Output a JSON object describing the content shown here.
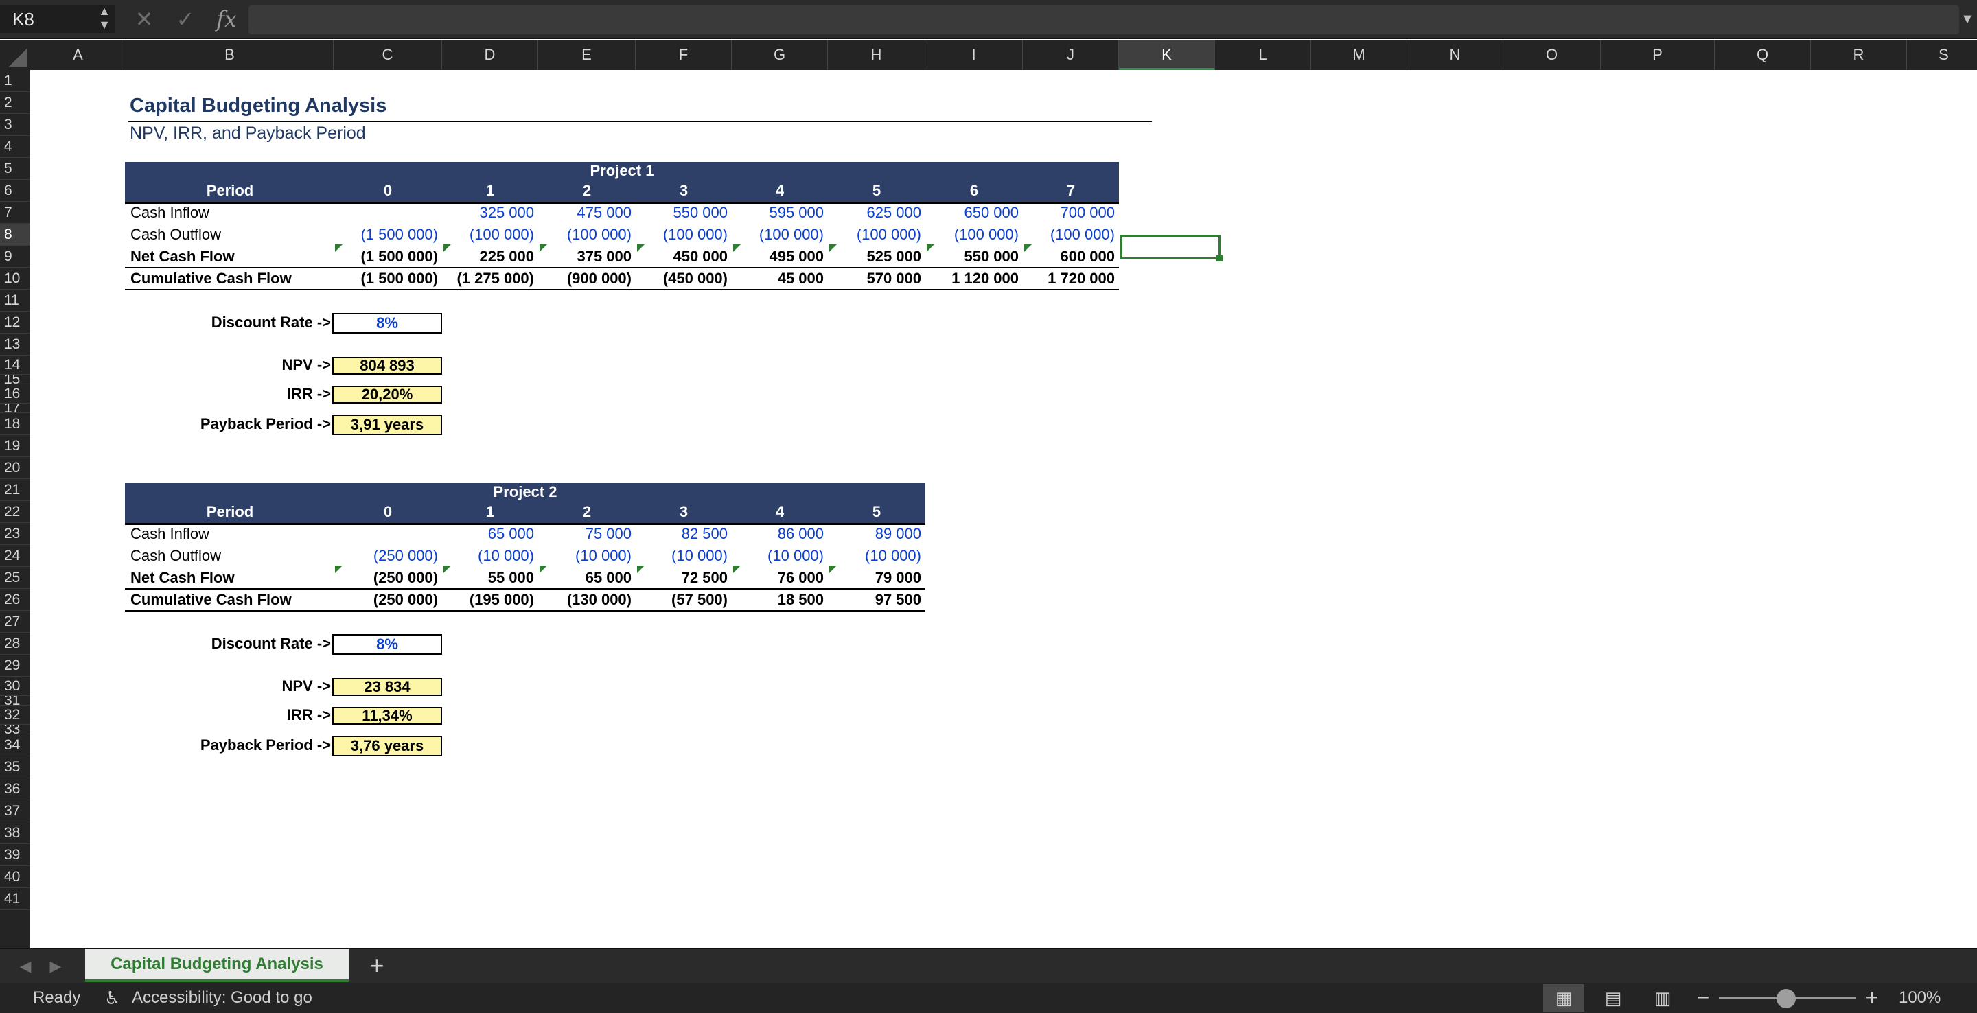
{
  "formula_bar": {
    "name_box": "K8",
    "formula": ""
  },
  "columns": [
    "A",
    "B",
    "C",
    "D",
    "E",
    "F",
    "G",
    "H",
    "I",
    "J",
    "K",
    "L",
    "M",
    "N",
    "O",
    "P",
    "Q",
    "R",
    "S"
  ],
  "active_column": "K",
  "rows": [
    "1",
    "2",
    "3",
    "4",
    "5",
    "6",
    "7",
    "8",
    "9",
    "10",
    "11",
    "12",
    "13",
    "14",
    "15",
    "16",
    "17",
    "18",
    "19",
    "20",
    "21",
    "22",
    "23",
    "24",
    "25",
    "26",
    "27",
    "28",
    "29",
    "30",
    "31",
    "32",
    "33",
    "34",
    "35",
    "36",
    "37",
    "38",
    "39",
    "40",
    "41"
  ],
  "active_row": "8",
  "sheet": {
    "title": "Capital Budgeting Analysis",
    "subtitle": "NPV, IRR, and Payback Period",
    "project1": {
      "name": "Project 1",
      "period_label": "Period",
      "periods": [
        "0",
        "1",
        "2",
        "3",
        "4",
        "5",
        "6",
        "7"
      ],
      "rows": [
        {
          "label": "Cash Inflow",
          "values": [
            "",
            "325 000",
            "475 000",
            "550 000",
            "595 000",
            "625 000",
            "650 000",
            "700 000"
          ]
        },
        {
          "label": "Cash Outflow",
          "values": [
            "(1 500 000)",
            "(100 000)",
            "(100 000)",
            "(100 000)",
            "(100 000)",
            "(100 000)",
            "(100 000)",
            "(100 000)"
          ]
        },
        {
          "label": "Net Cash Flow",
          "values": [
            "(1 500 000)",
            "225 000",
            "375 000",
            "450 000",
            "495 000",
            "525 000",
            "550 000",
            "600 000"
          ]
        },
        {
          "label": "Cumulative Cash Flow",
          "values": [
            "(1 500 000)",
            "(1 275 000)",
            "(900 000)",
            "(450 000)",
            "45 000",
            "570 000",
            "1 120 000",
            "1 720 000"
          ]
        }
      ],
      "discount_label": "Discount Rate ->",
      "discount": "8%",
      "npv_label": "NPV ->",
      "npv": "804 893",
      "irr_label": "IRR ->",
      "irr": "20,20%",
      "payback_label": "Payback Period ->",
      "payback": "3,91 years"
    },
    "project2": {
      "name": "Project 2",
      "period_label": "Period",
      "periods": [
        "0",
        "1",
        "2",
        "3",
        "4",
        "5"
      ],
      "rows": [
        {
          "label": "Cash Inflow",
          "values": [
            "",
            "65 000",
            "75 000",
            "82 500",
            "86 000",
            "89 000"
          ]
        },
        {
          "label": "Cash Outflow",
          "values": [
            "(250 000)",
            "(10 000)",
            "(10 000)",
            "(10 000)",
            "(10 000)",
            "(10 000)"
          ]
        },
        {
          "label": "Net Cash Flow",
          "values": [
            "(250 000)",
            "55 000",
            "65 000",
            "72 500",
            "76 000",
            "79 000"
          ]
        },
        {
          "label": "Cumulative Cash Flow",
          "values": [
            "(250 000)",
            "(195 000)",
            "(130 000)",
            "(57 500)",
            "18 500",
            "97 500"
          ]
        }
      ],
      "discount_label": "Discount Rate ->",
      "discount": "8%",
      "npv_label": "NPV ->",
      "npv": "23 834",
      "irr_label": "IRR ->",
      "irr": "11,34%",
      "payback_label": "Payback Period ->",
      "payback": "3,76 years"
    }
  },
  "tabs": {
    "sheet_name": "Capital Budgeting Analysis",
    "add": "+"
  },
  "status": {
    "ready": "Ready",
    "accessibility": "Accessibility: Good to go",
    "zoom": "100%"
  },
  "colors": {
    "header_band": "#2f4068",
    "input_blue": "#0b3fd1",
    "output_fill": "#fdf6a9",
    "accent_green": "#2f7d32"
  }
}
